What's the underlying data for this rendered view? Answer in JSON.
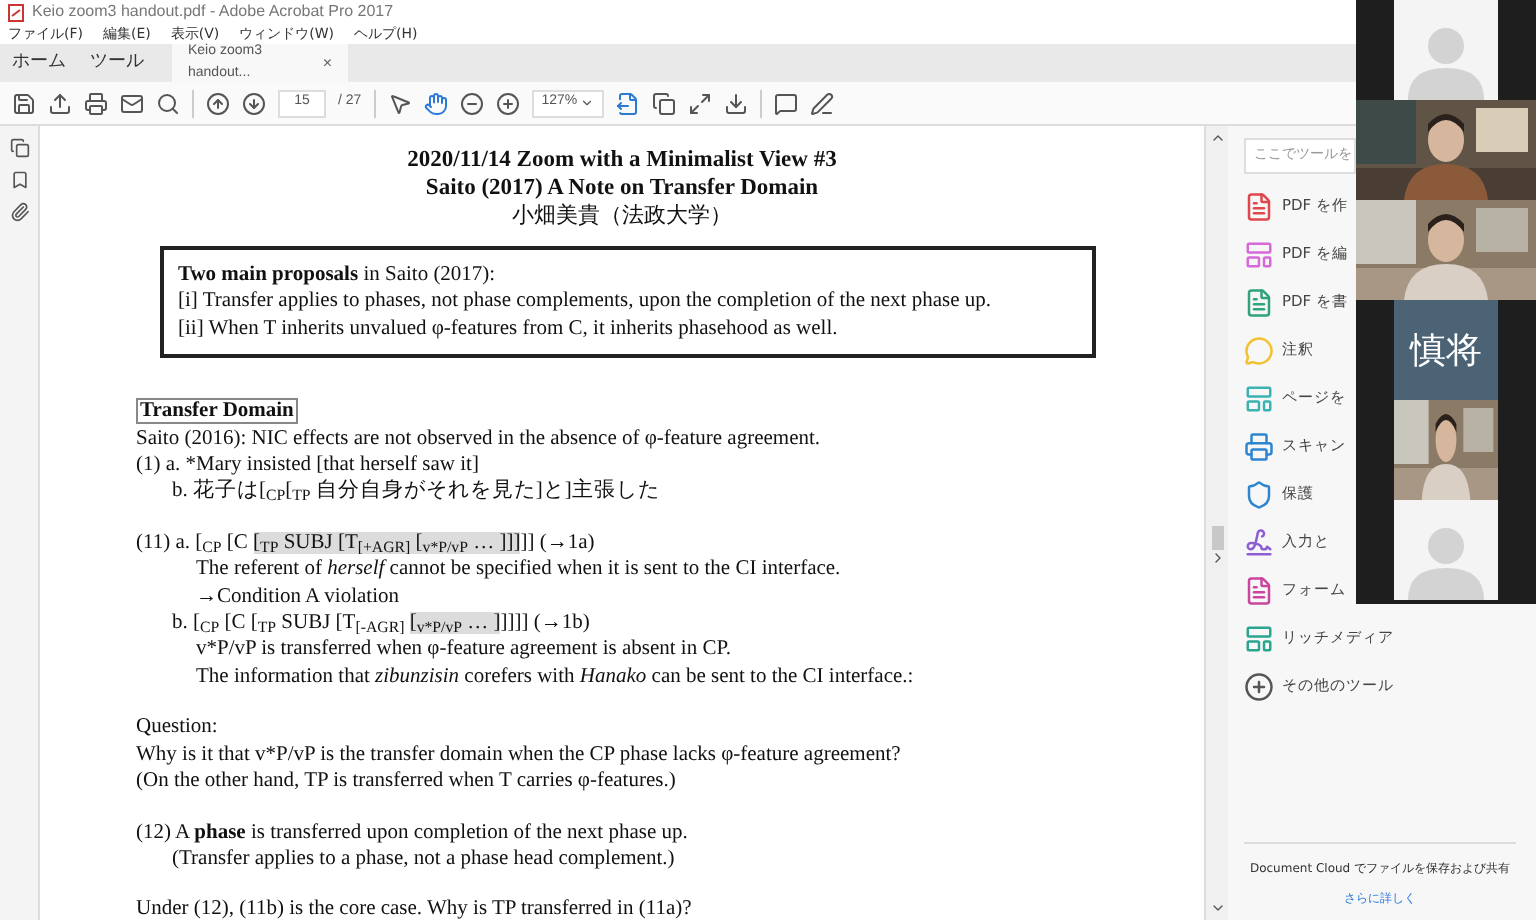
{
  "window": {
    "title": "Keio zoom3 handout.pdf - Adobe Acrobat Pro 2017"
  },
  "menu": [
    "ファイル(F)",
    "編集(E)",
    "表示(V)",
    "ウィンドウ(W)",
    "ヘルプ(H)"
  ],
  "tabs": [
    {
      "label": "ホーム",
      "selected": false,
      "kind": "nav"
    },
    {
      "label": "ツール",
      "selected": false,
      "kind": "nav"
    },
    {
      "label": "Keio zoom3 handout...",
      "selected": true,
      "kind": "document",
      "close": "×"
    }
  ],
  "toolbar": {
    "page": "15",
    "total": "/ 27",
    "zoom": "127%",
    "hand_tool_on": true
  },
  "document": {
    "title": [
      "2020/11/14 Zoom with a Minimalist View #3",
      "Saito (2017) A Note on Transfer Domain"
    ],
    "author": "小畑美貴（法政大学）",
    "box": [
      "**Two main proposals** in Saito (2017):",
      "[i] Transfer applies to phases, not phase complements, upon the completion of the next phase up.",
      "[ii] When T inherits unvalued φ-features from C, it inherits phasehood as well."
    ],
    "heading": "Transfer Domain",
    "blocks": [
      {
        "lines": [
          {
            "kind": "plain",
            "segments": [
              {
                "text": "Saito (2016): NIC effects are not observed in the absence of φ-feature agreement.",
                "highlight": false
              }
            ]
          },
          {
            "kind": "plain",
            "segments": [
              {
                "text": "(1) a. *Mary insisted [that herself saw it]",
                "highlight": false
              }
            ]
          },
          {
            "kind": "item",
            "segments": [
              {
                "text": "b.  花子は[$_{CP}$[$_{TP}$ 自分自身がそれを見た]と]主張した",
                "highlight": false
              }
            ]
          }
        ]
      },
      {
        "lines": [
          {
            "kind": "plain",
            "segments": [
              {
                "text": "(11) a. [$_{CP}$ [C ",
                "highlight": false
              },
              {
                "text": "[$_{TP}$ SUBJ [T$_{[+AGR]}$ [$_{v*P/vP}$ … ]]]",
                "highlight": true
              },
              {
                "text": "]] (→1a)",
                "highlight": false
              }
            ]
          },
          {
            "kind": "detail",
            "segments": [
              {
                "text": "The referent of *herself* cannot be specified when it is sent to the CI interface.",
                "highlight": false
              }
            ]
          },
          {
            "kind": "detail",
            "segments": [
              {
                "text": "→Condition A violation",
                "highlight": false
              }
            ]
          },
          {
            "kind": "item",
            "segments": [
              {
                "text": "b. [$_{CP}$ [C [$_{TP}$ SUBJ [T$_{[-AGR]}$ ",
                "highlight": false
              },
              {
                "text": "[$_{v*P/vP}$ … ]",
                "highlight": true
              },
              {
                "text": "]]]] (→1b)",
                "highlight": false
              }
            ]
          },
          {
            "kind": "detail",
            "segments": [
              {
                "text": "v*P/vP is transferred when φ-feature agreement is absent in CP.",
                "highlight": false
              }
            ]
          },
          {
            "kind": "detail",
            "segments": [
              {
                "text": "The information that *zibunzisin* corefers with *Hanako* can be sent to the CI interface.:",
                "highlight": false
              }
            ]
          }
        ]
      },
      {
        "lines": [
          {
            "kind": "plain",
            "segments": [
              {
                "text": "Question:",
                "highlight": false
              }
            ]
          },
          {
            "kind": "plain",
            "segments": [
              {
                "text": "Why is it that v*P/vP is the transfer domain when the CP phase lacks φ-feature agreement?",
                "highlight": false
              }
            ]
          },
          {
            "kind": "plain",
            "segments": [
              {
                "text": "(On the other hand, TP is transferred when T carries φ-features.)",
                "highlight": false
              }
            ]
          }
        ]
      },
      {
        "lines": [
          {
            "kind": "plain",
            "segments": [
              {
                "text": "(12) A **phase** is transferred upon completion of the next phase up.",
                "highlight": false
              }
            ]
          },
          {
            "kind": "item",
            "segments": [
              {
                "text": "(Transfer applies to a phase, not a phase head complement.)",
                "highlight": false
              }
            ]
          }
        ]
      },
      {
        "lines": [
          {
            "kind": "plain",
            "segments": [
              {
                "text": "Under (12), (11b) is the core case. Why is TP transferred in (11a)?",
                "highlight": false
              }
            ]
          }
        ]
      }
    ]
  },
  "tools_pane": {
    "search": {
      "placeholder": "ここでツールを"
    },
    "items": [
      {
        "label": "PDF を作",
        "color": "#e0474c",
        "kind": "file"
      },
      {
        "label": "PDF を編",
        "color": "#d66ad8",
        "kind": "layout"
      },
      {
        "label": "PDF を書",
        "color": "#2fa37a",
        "kind": "file"
      },
      {
        "label": "注釈",
        "color": "#f2c230",
        "kind": "comment"
      },
      {
        "label": "ページを",
        "color": "#3bb3b3",
        "kind": "layout"
      },
      {
        "label": "スキャン",
        "color": "#2e86d1",
        "kind": "printer"
      },
      {
        "label": "保護",
        "color": "#2e86d1",
        "kind": "shield"
      },
      {
        "label": "入力と",
        "color": "#8d5fd3",
        "kind": "pen"
      },
      {
        "label": "フォーム",
        "color": "#c9459e",
        "kind": "file"
      },
      {
        "label": "リッチメディア",
        "color": "#2aa58f",
        "kind": "layout"
      },
      {
        "label": "その他のツール",
        "color": "#555555",
        "kind": "plus"
      }
    ],
    "footer": "Document Cloud でファイルを保存および共有",
    "link": "さらに詳しく"
  },
  "gallery": [
    {
      "kind": "avatar"
    },
    {
      "kind": "video"
    },
    {
      "kind": "video"
    },
    {
      "kind": "name",
      "label": "慎将"
    },
    {
      "kind": "video"
    },
    {
      "kind": "avatar"
    }
  ]
}
